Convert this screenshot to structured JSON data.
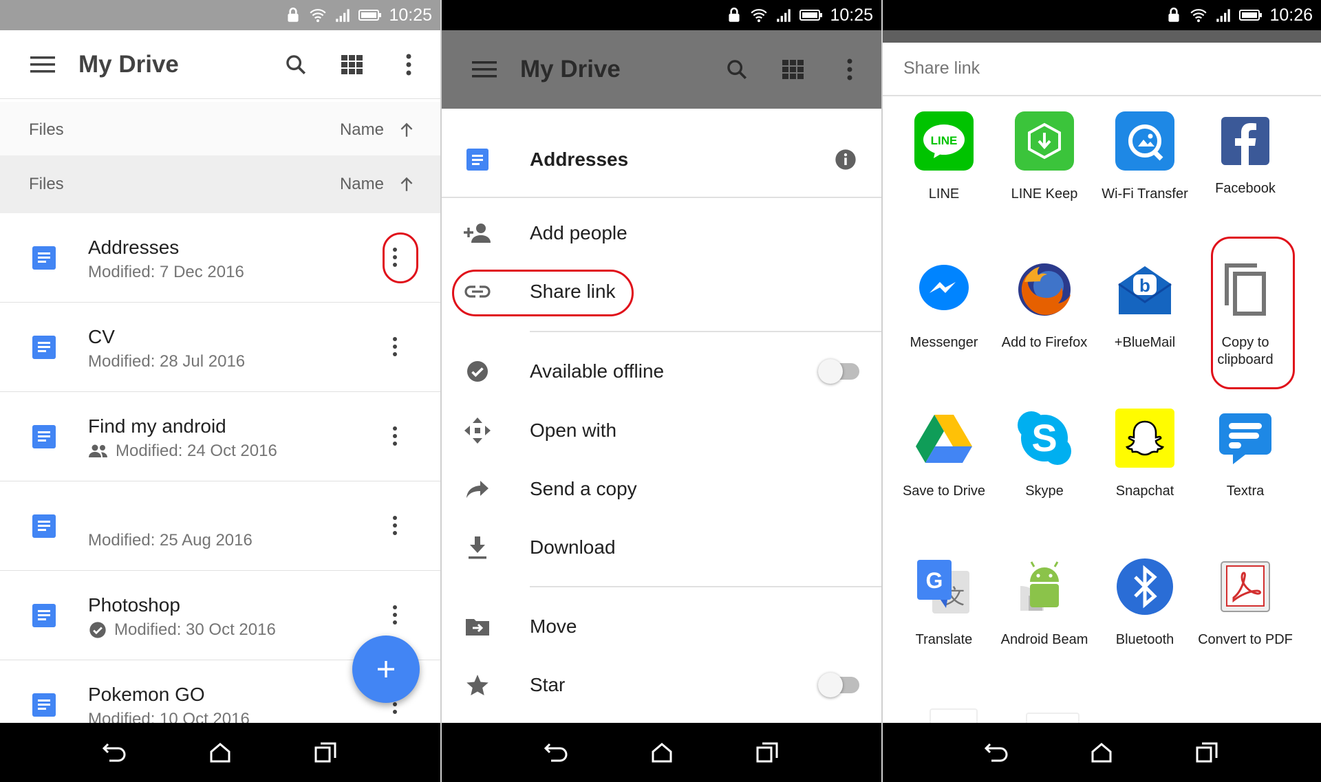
{
  "status_bars": [
    {
      "time": "10:25"
    },
    {
      "time": "10:25"
    },
    {
      "time": "10:26"
    }
  ],
  "drive": {
    "title": "My Drive",
    "files_label": "Files",
    "sort_label": "Name",
    "files": [
      {
        "name": "Addresses",
        "modified": "Modified: 7 Dec 2016",
        "badge": ""
      },
      {
        "name": "CV",
        "modified": "Modified: 28 Jul 2016",
        "badge": ""
      },
      {
        "name": "Find my android",
        "modified": "Modified: 24 Oct 2016",
        "badge": "shared-icon"
      },
      {
        "name": "",
        "modified": "Modified: 25 Aug 2016",
        "badge": ""
      },
      {
        "name": "Photoshop",
        "modified": "Modified: 30 Oct 2016",
        "badge": "offline-icon"
      },
      {
        "name": "Pokemon GO",
        "modified": "Modified: 10 Oct 2016",
        "badge": ""
      }
    ],
    "fab_icon": "plus-icon"
  },
  "sheet": {
    "file_name": "Addresses",
    "items": [
      {
        "label": "Add people",
        "icon": "add-person-icon"
      },
      {
        "label": "Share link",
        "icon": "link-icon"
      },
      {
        "label": "Available offline",
        "icon": "offline-icon",
        "toggle": false
      },
      {
        "label": "Open with",
        "icon": "open-with-icon"
      },
      {
        "label": "Send a copy",
        "icon": "send-icon"
      },
      {
        "label": "Download",
        "icon": "download-icon"
      },
      {
        "label": "Move",
        "icon": "move-icon"
      },
      {
        "label": "Star",
        "icon": "star-icon",
        "toggle": false
      }
    ]
  },
  "share": {
    "title": "Share link",
    "apps": [
      {
        "label": "LINE",
        "icon": "line-icon",
        "color": "#00c300"
      },
      {
        "label": "LINE Keep",
        "icon": "line-keep-icon",
        "color": "#3bc43b"
      },
      {
        "label": "Wi-Fi Transfer",
        "icon": "wifi-transfer-icon",
        "color": "#1e88e5"
      },
      {
        "label": "Facebook",
        "icon": "facebook-icon",
        "color": "#3b5998"
      },
      {
        "label": "Messenger",
        "icon": "messenger-icon",
        "color": "#0084ff"
      },
      {
        "label": "Add to Firefox",
        "icon": "firefox-icon",
        "color": "#e66000"
      },
      {
        "label": "+BlueMail",
        "icon": "bluemail-icon",
        "color": "#1565c0"
      },
      {
        "label": "Copy to clipboard",
        "icon": "copy-icon",
        "color": "#757575"
      },
      {
        "label": "Save to Drive",
        "icon": "drive-icon",
        "color": "#0f9d58"
      },
      {
        "label": "Skype",
        "icon": "skype-icon",
        "color": "#00aff0"
      },
      {
        "label": "Snapchat",
        "icon": "snapchat-icon",
        "color": "#fffc00"
      },
      {
        "label": "Textra",
        "icon": "textra-icon",
        "color": "#1e88e5"
      },
      {
        "label": "Translate",
        "icon": "translate-icon",
        "color": "#4285f4"
      },
      {
        "label": "Android Beam",
        "icon": "android-icon",
        "color": "#8bc34a"
      },
      {
        "label": "Bluetooth",
        "icon": "bluetooth-icon",
        "color": "#2a6dd6"
      },
      {
        "label": "Convert to PDF",
        "icon": "pdf-icon",
        "color": "#d32f2f"
      }
    ]
  },
  "colors": {
    "accent": "#4285f4",
    "highlight": "#e0101a"
  }
}
